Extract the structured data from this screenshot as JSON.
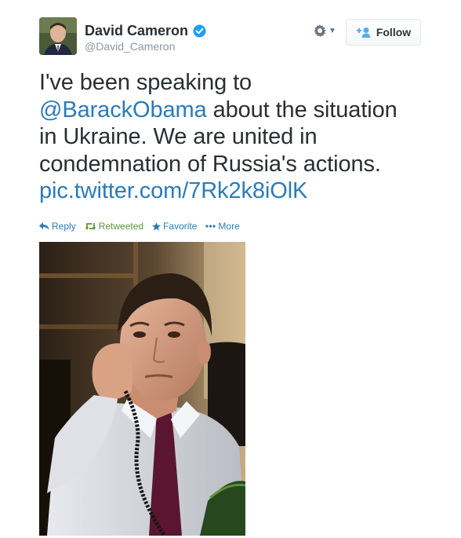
{
  "author": {
    "display_name": "David Cameron",
    "handle": "@David_Cameron",
    "verified": true,
    "avatar_icon": "profile-photo"
  },
  "header": {
    "follow_label": "Follow",
    "gear_icon": "gear-icon",
    "follow_icon": "add-user-icon"
  },
  "tweet": {
    "lines": [
      {
        "before": "I've been speaking to",
        "link": "",
        "after": ""
      },
      {
        "before": "",
        "link": "@BarackObama",
        "after": " about the situation"
      },
      {
        "before": "in Ukraine. We are united in",
        "link": "",
        "after": ""
      },
      {
        "before": "condemnation of Russia's actions.",
        "link": "",
        "after": ""
      },
      {
        "before": "",
        "link": "pic.twitter.com/7Rk2k8iOlK",
        "after": ""
      }
    ]
  },
  "actions": {
    "reply": "Reply",
    "retweet": "Retweeted",
    "favorite": "Favorite",
    "more": "More"
  },
  "colors": {
    "link": "#2b7bb9",
    "retweeted": "#5c913b",
    "text": "#292f33",
    "muted": "#8899a6",
    "verified": "#1da1f2"
  }
}
